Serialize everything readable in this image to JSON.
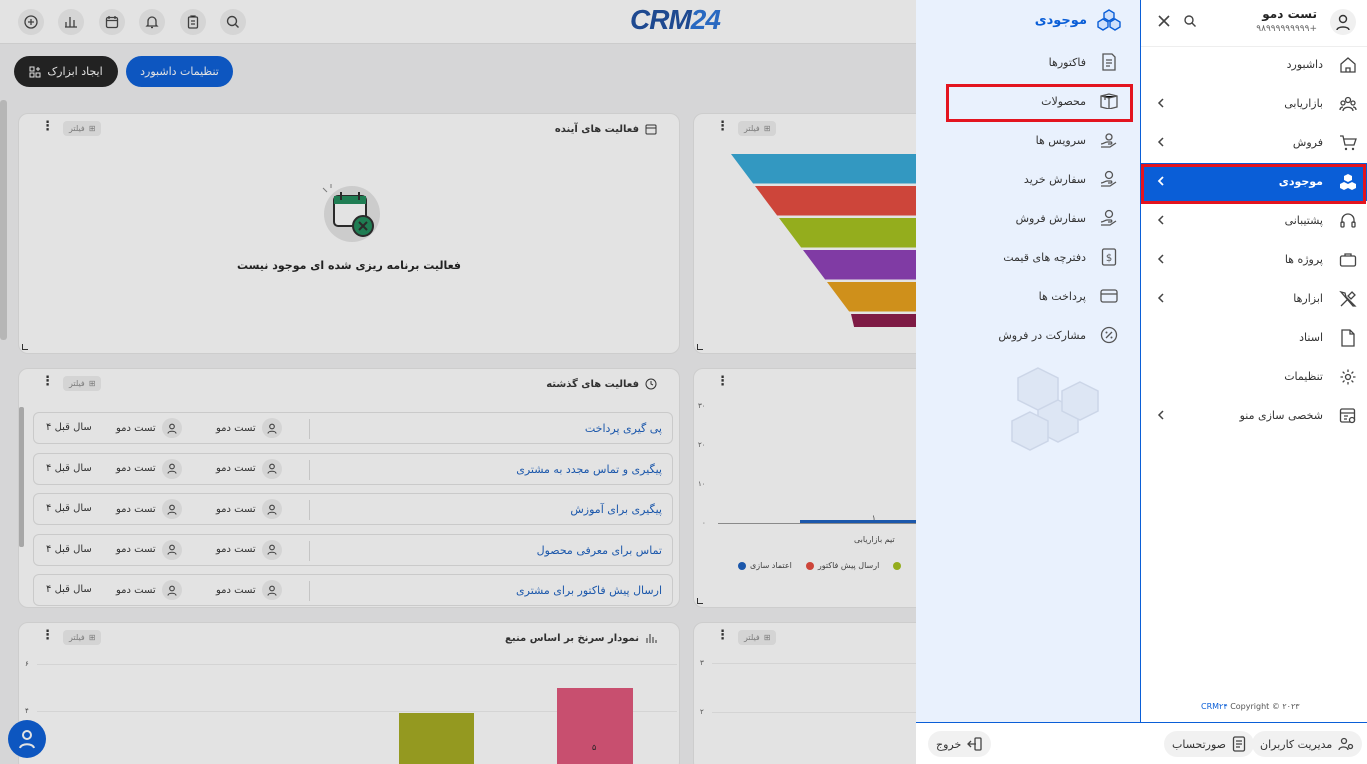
{
  "header": {
    "logo_text": "CRM",
    "logo_num": "24",
    "create_widget_label": "ایجاد ابزارک",
    "dashboard_settings_label": "تنظیمات داشبورد"
  },
  "cards": {
    "upcoming": {
      "title": "فعالیت های آینده",
      "filter_label": "فیلتر",
      "empty_text": "فعالیت برنامه ریزی شده ای موجود نیست"
    },
    "funnel": {
      "filter_label": "فیلتر",
      "colors": [
        "#35a9d8",
        "#e64a3d",
        "#a5c21c",
        "#8e3fb7",
        "#e9a01a",
        "#8b1a4a"
      ]
    },
    "past": {
      "title": "فعالیت های گذشته",
      "filter_label": "فیلتر",
      "rows": [
        {
          "title": "پی گیری پرداخت",
          "user1": "تست دمو",
          "user2": "تست دمو",
          "time": "۴ سال قبل"
        },
        {
          "title": "پیگیری و تماس مجدد به مشتری",
          "user1": "تست دمو",
          "user2": "تست دمو",
          "time": "۴ سال قبل"
        },
        {
          "title": "پیگیری برای آموزش",
          "user1": "تست دمو",
          "user2": "تست دمو",
          "time": "۴ سال قبل"
        },
        {
          "title": "تماس برای معرفی محصول",
          "user1": "تست دمو",
          "user2": "تست دمو",
          "time": "۴ سال قبل"
        },
        {
          "title": "ارسال پیش فاکتور برای مشتری",
          "user1": "تست دمو",
          "user2": "تست دمو",
          "time": "۴ سال قبل"
        }
      ]
    },
    "team": {
      "y_ticks": [
        "۳۰",
        "۲۰",
        "۱۰",
        "۰"
      ],
      "bar_value": "۱",
      "category": "تیم بازاریابی",
      "legend": [
        {
          "label": "اعتماد سازی",
          "color": "#1a5fbf"
        },
        {
          "label": "ارسال پیش فاکتور",
          "color": "#e64a3d"
        },
        {
          "label": "",
          "color": "#a5c21c"
        }
      ]
    },
    "source": {
      "title": "نمودار سرنخ بر اساس منبع",
      "filter_label": "فیلتر",
      "y_ticks": [
        "۶",
        "۴"
      ],
      "bar_label": "۵"
    },
    "bottom_right": {
      "filter_label": "فیلتر",
      "y_ticks": [
        "۳",
        "۲"
      ]
    }
  },
  "subpanel": {
    "title": "موجودی",
    "items": [
      {
        "label": "فاکتورها"
      },
      {
        "label": "محصولات"
      },
      {
        "label": "سرویس ها"
      },
      {
        "label": "سفارش خرید"
      },
      {
        "label": "سفارش فروش"
      },
      {
        "label": "دفترچه های قیمت"
      },
      {
        "label": "پرداخت ها"
      },
      {
        "label": "مشارکت در فروش"
      }
    ]
  },
  "sidebar": {
    "user_name": "تست دمو",
    "user_phone": "۹۸۹۹۹۹۹۹۹۹۹+",
    "items": [
      {
        "label": "داشبورد"
      },
      {
        "label": "بازاریابی"
      },
      {
        "label": "فروش"
      },
      {
        "label": "موجودی"
      },
      {
        "label": "پشتیبانی"
      },
      {
        "label": "پروژه ها"
      },
      {
        "label": "ابزارها"
      },
      {
        "label": "اسناد"
      },
      {
        "label": "تنظیمات"
      },
      {
        "label": "شخصی سازی منو"
      }
    ],
    "copyright_prefix": "Copyright © ۲۰۲۳",
    "copyright_brand": "CRM۲۴"
  },
  "footer": {
    "user_mgmt_label": "مدیریت کاربران",
    "invoice_label": "صورتحساب",
    "logout_label": "خروج"
  }
}
